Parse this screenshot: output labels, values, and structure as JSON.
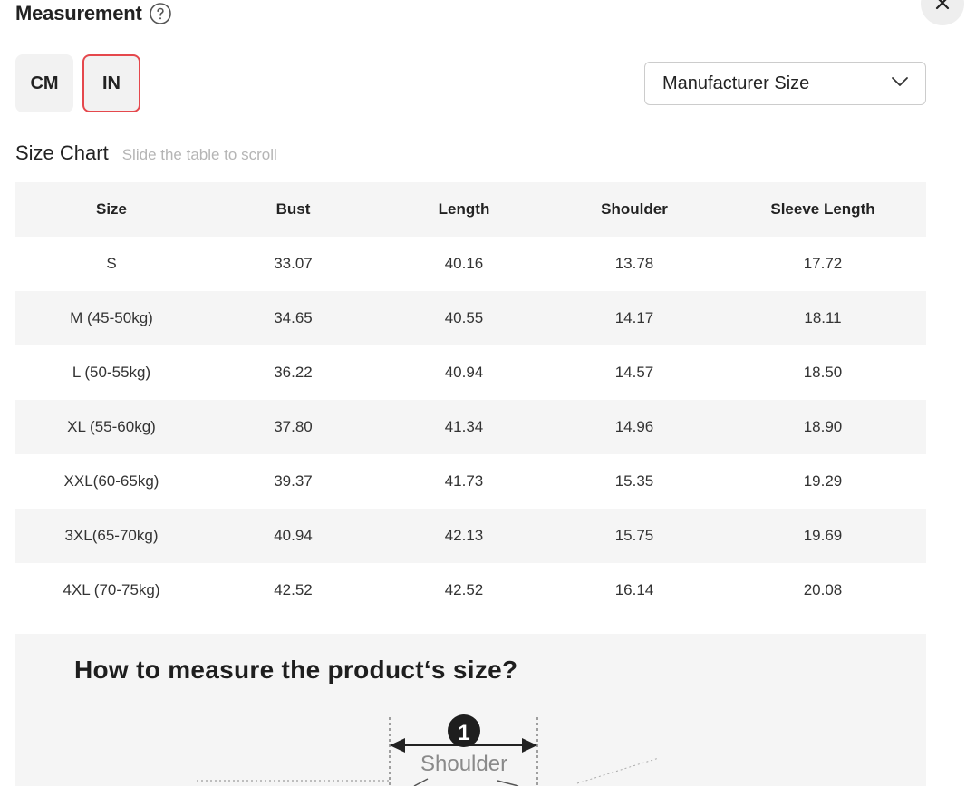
{
  "header": {
    "title": "Measurement",
    "help_icon": "question-circle-icon",
    "close_icon": "close-icon"
  },
  "units": [
    {
      "label": "CM",
      "active": false
    },
    {
      "label": "IN",
      "active": true
    }
  ],
  "size_select": {
    "value": "Manufacturer Size",
    "icon": "chevron-down-icon"
  },
  "size_chart": {
    "title": "Size Chart",
    "hint": "Slide the table to scroll",
    "columns": [
      "Size",
      "Bust",
      "Length",
      "Shoulder",
      "Sleeve Length"
    ],
    "rows": [
      [
        "S",
        "33.07",
        "40.16",
        "13.78",
        "17.72"
      ],
      [
        "M (45-50kg)",
        "34.65",
        "40.55",
        "14.17",
        "18.11"
      ],
      [
        "L (50-55kg)",
        "36.22",
        "40.94",
        "14.57",
        "18.50"
      ],
      [
        "XL (55-60kg)",
        "37.80",
        "41.34",
        "14.96",
        "18.90"
      ],
      [
        "XXL(60-65kg)",
        "39.37",
        "41.73",
        "15.35",
        "19.29"
      ],
      [
        "3XL(65-70kg)",
        "40.94",
        "42.13",
        "15.75",
        "19.69"
      ],
      [
        "4XL (70-75kg)",
        "42.52",
        "42.52",
        "16.14",
        "20.08"
      ]
    ]
  },
  "guide": {
    "title": "How to measure the product‘s size?",
    "marker_number": "1",
    "marker_label": "Shoulder"
  },
  "colors": {
    "accent_border": "#e5484d",
    "row_stripe": "#f5f5f5",
    "hint_text": "#b5b5b5"
  }
}
